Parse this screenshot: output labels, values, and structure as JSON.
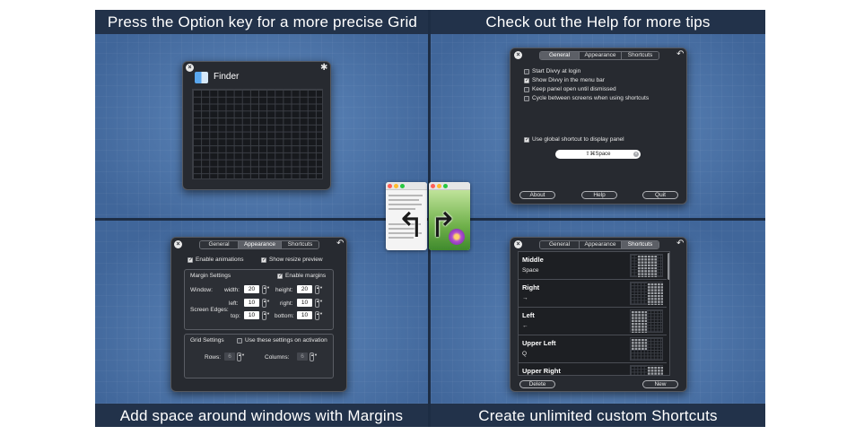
{
  "captions": {
    "top_left": "Press the Option key for a more precise Grid",
    "top_right": "Check out the Help for more tips",
    "bottom_left": "Add space around windows with Margins",
    "bottom_right": "Create unlimited custom Shortcuts"
  },
  "icons": {
    "close": "×",
    "gear": "✱",
    "back": "↶",
    "check": "✓",
    "clear": "×",
    "stepper": "▲▼",
    "arrow_left": "↰",
    "arrow_right": "↱"
  },
  "colors": {
    "background": "#4d77ac",
    "caption_bar": "#22324a",
    "panel": "#272a30",
    "active_tab": "#5c5f66"
  },
  "finder_panel": {
    "title": "Finder"
  },
  "tabs": {
    "general": "General",
    "appearance": "Appearance",
    "shortcuts": "Shortcuts"
  },
  "general_panel": {
    "checkboxes": [
      {
        "label": "Start Divvy at login",
        "checked": false
      },
      {
        "label": "Show Divvy in the menu bar",
        "checked": true
      },
      {
        "label": "Keep panel open until dismissed",
        "checked": false
      },
      {
        "label": "Cycle between screens when using shortcuts",
        "checked": false
      }
    ],
    "global_shortcut": {
      "label": "Use global shortcut to display panel",
      "checked": true
    },
    "shortcut_value": "⇧⌘Space",
    "buttons": {
      "about": "About",
      "help": "Help",
      "quit": "Quit"
    }
  },
  "appearance_panel": {
    "enable_animations": "Enable animations",
    "show_resize_preview": "Show resize preview",
    "margin_settings": "Margin Settings",
    "enable_margins": "Enable margins",
    "window_label": "Window:",
    "width_label": "width:",
    "width_value": "20",
    "height_label": "height:",
    "height_value": "20",
    "screen_edges_label": "Screen Edges:",
    "left_label": "left:",
    "left_value": "10",
    "right_label": "right:",
    "right_value": "10",
    "top_label": "top:",
    "top_value": "10",
    "bottom_label": "bottom:",
    "bottom_value": "10",
    "grid_settings": "Grid Settings",
    "use_on_activation": "Use these settings on activation",
    "rows_label": "Rows:",
    "rows_value": "6",
    "columns_label": "Columns:",
    "columns_value": "6"
  },
  "shortcuts_panel": {
    "items": [
      {
        "name": "Middle",
        "key": "Space"
      },
      {
        "name": "Right",
        "key": "→"
      },
      {
        "name": "Left",
        "key": "←"
      },
      {
        "name": "Upper Left",
        "key": "Q"
      },
      {
        "name": "Upper Right",
        "key": ""
      }
    ],
    "delete_label": "Delete",
    "new_label": "New"
  }
}
